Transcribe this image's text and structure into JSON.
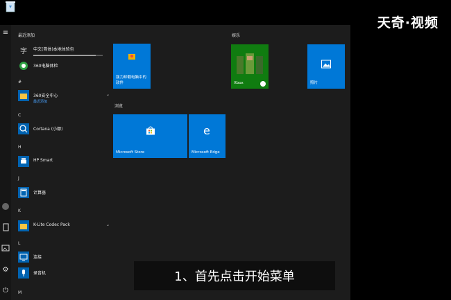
{
  "watermark": "天奇·视频",
  "app_list": {
    "recent_header": "最近添加",
    "items": [
      {
        "label": "中文(简体)本地体验包",
        "progress": 0.9
      },
      {
        "label": "360电脑体检"
      },
      {
        "letter": "#"
      },
      {
        "label": "360安全中心",
        "sub": "最近添加",
        "expandable": true
      },
      {
        "letter": "C"
      },
      {
        "label": "Cortana (小娜)"
      },
      {
        "letter": "H"
      },
      {
        "label": "HP Smart"
      },
      {
        "letter": "J"
      },
      {
        "label": "计算器"
      },
      {
        "letter": "K"
      },
      {
        "label": "K-Lite Codec Pack",
        "expandable": true
      },
      {
        "letter": "L"
      },
      {
        "label": "连接"
      },
      {
        "label": "录音机"
      },
      {
        "letter": "M"
      }
    ]
  },
  "groups": {
    "entertainment": "娱乐",
    "browse": "浏览"
  },
  "tiles": {
    "uninstall": "强力卸载电脑中的软件",
    "xbox": "Xbox",
    "photos": "照片",
    "store": "Microsoft Store",
    "edge": "Microsoft Edge"
  },
  "caption": "1、首先点击开始菜单",
  "chevron": "⌄",
  "colors": {
    "tile": "#0078d7",
    "xbox_tile": "#107c10",
    "menu_bg": "#1c1c1c"
  }
}
